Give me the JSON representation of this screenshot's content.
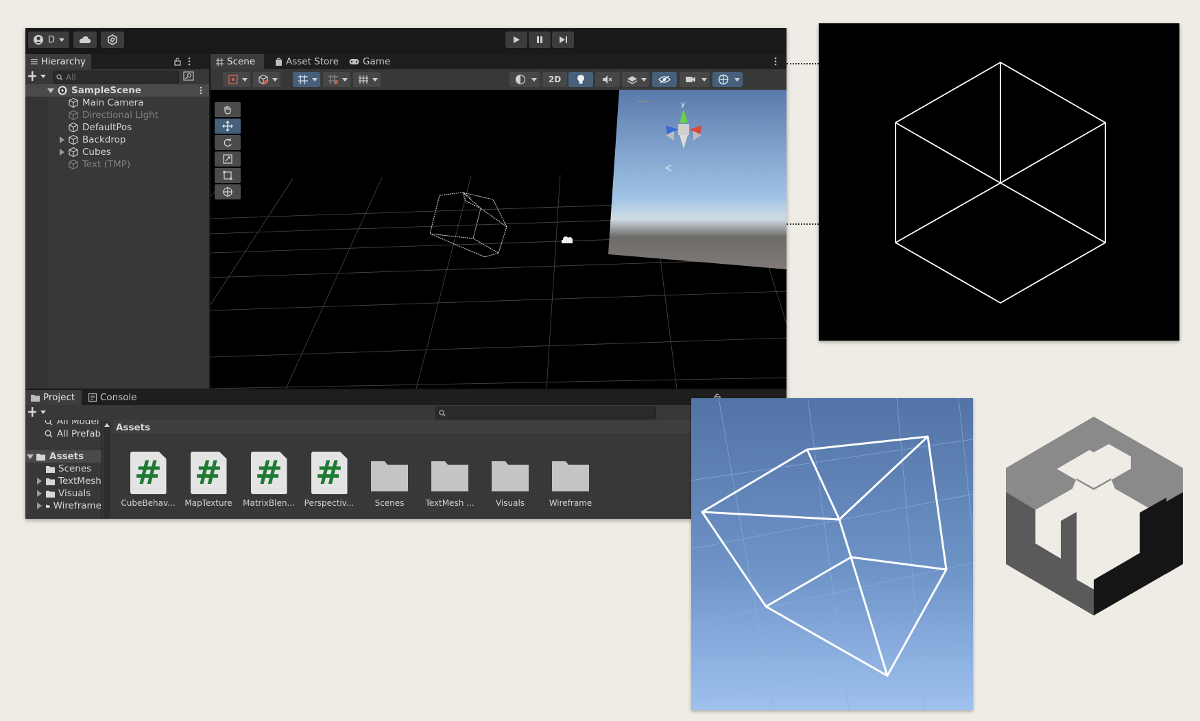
{
  "toolbar": {
    "account_label": "D",
    "play_icon": "play-icon",
    "pause_icon": "pause-icon",
    "step_icon": "step-icon"
  },
  "hierarchy": {
    "tab_label": "Hierarchy",
    "search_placeholder": "All",
    "scene_name": "SampleScene",
    "items": [
      {
        "label": "Main Camera",
        "dim": false
      },
      {
        "label": "Directional Light",
        "dim": true
      },
      {
        "label": "DefaultPos",
        "dim": false
      },
      {
        "label": "Backdrop",
        "dim": false
      },
      {
        "label": "Cubes",
        "dim": false
      },
      {
        "label": "Text (TMP)",
        "dim": true
      }
    ]
  },
  "scene": {
    "tabs": [
      "Scene",
      "Asset Store",
      "Game"
    ],
    "toggle_2d": "2D",
    "gizmo_axis_y": "y"
  },
  "project": {
    "tabs": [
      "Project",
      "Console"
    ],
    "breadcrumb": "Assets",
    "tree": [
      {
        "label": "All Model",
        "kind": "search"
      },
      {
        "label": "All Prefab",
        "kind": "search"
      },
      {
        "label": "Assets",
        "kind": "root"
      },
      {
        "label": "Scenes",
        "kind": "folder"
      },
      {
        "label": "TextMesh",
        "kind": "folder"
      },
      {
        "label": "Visuals",
        "kind": "folder"
      },
      {
        "label": "Wireframe",
        "kind": "folder"
      }
    ],
    "assets": [
      {
        "label": "CubeBehav...",
        "type": "script"
      },
      {
        "label": "MapTexture",
        "type": "script"
      },
      {
        "label": "MatrixBlen...",
        "type": "script"
      },
      {
        "label": "Perspectiv...",
        "type": "script"
      },
      {
        "label": "Scenes",
        "type": "folder"
      },
      {
        "label": "TextMesh ...",
        "type": "folder"
      },
      {
        "label": "Visuals",
        "type": "folder"
      },
      {
        "label": "Wireframe",
        "type": "folder"
      }
    ]
  },
  "colors": {
    "background": "#efece5",
    "editor_dark": "#191919",
    "panel": "#383838",
    "selection_blue": "#46607c",
    "csharp_green": "#1f7a34"
  }
}
